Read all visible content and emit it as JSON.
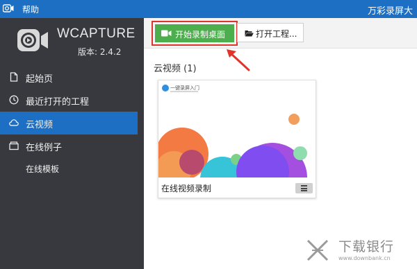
{
  "titlebar": {
    "help_label": "帮助",
    "title": "万彩录屏大",
    "icon": "camera-app-icon",
    "color": "#1d6fc4"
  },
  "brand": {
    "name": "WCAPTURE",
    "version": "版本: 2.4.2",
    "logo_icon": "wcapture-logo-icon"
  },
  "sidebar": {
    "background": "#37393e",
    "active_color": "#1d6fc4",
    "items": [
      {
        "label": "起始页",
        "icon": "file-icon",
        "active": false
      },
      {
        "label": "最近打开的工程",
        "icon": "clock-icon",
        "active": false
      },
      {
        "label": "云视频",
        "icon": "cloud-icon",
        "active": true
      },
      {
        "label": "在线例子",
        "icon": "folder-icon",
        "active": false
      },
      {
        "label": "在线模板",
        "icon": "",
        "active": false
      }
    ]
  },
  "toolbar": {
    "record_label": "开始录制桌面",
    "record_icon": "video-camera-icon",
    "record_color": "#4cae4c",
    "highlight_color": "#e0342b",
    "open_label": "打开工程...",
    "open_icon": "folder-open-icon"
  },
  "main": {
    "section_title": "云视频 (1)"
  },
  "videos": [
    {
      "name": "在线视频录制",
      "thumb_text": "一键录屏入门",
      "menu_icon": "hamburger-menu-icon"
    }
  ],
  "watermark": {
    "name": "下载银行",
    "url": "www.downbank.cn"
  }
}
